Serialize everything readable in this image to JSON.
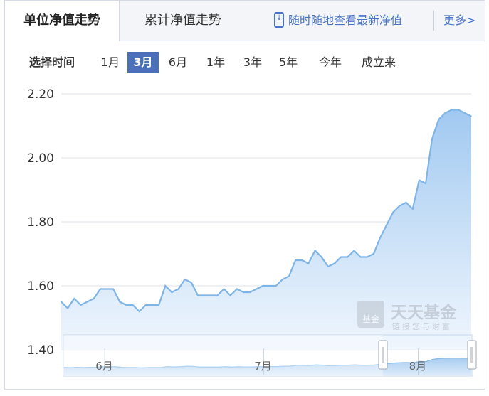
{
  "tabs": {
    "unit_nav": "单位净值走势",
    "accumulated_nav": "累计净值走势"
  },
  "mobile_link": "随时随地查看最新净值",
  "more_link": "更多>",
  "range": {
    "label": "选择时间",
    "options": [
      "1月",
      "3月",
      "6月",
      "1年",
      "3年",
      "5年",
      "今年",
      "成立来"
    ],
    "selected": "3月"
  },
  "watermark": {
    "logo_text": "基金",
    "brand": "天天基金",
    "slogan": "链接您与财富"
  },
  "colors": {
    "line": "#7eb4e6",
    "fill_top": "#9cc6f0",
    "fill_bottom": "#eaf3fc",
    "grid": "#dde1ea",
    "accent": "#4a70b8"
  },
  "chart_data": {
    "type": "area",
    "ylim": [
      1.4,
      2.2
    ],
    "yticks": [
      "1.40",
      "1.60",
      "1.80",
      "2.00",
      "2.20"
    ],
    "x": [
      0,
      1,
      2,
      3,
      4,
      5,
      6,
      7,
      8,
      9,
      10,
      11,
      12,
      13,
      14,
      15,
      16,
      17,
      18,
      19,
      20,
      21,
      22,
      23,
      24,
      25,
      26,
      27,
      28,
      29,
      30,
      31,
      32,
      33,
      34,
      35,
      36,
      37,
      38,
      39,
      40,
      41,
      42,
      43,
      44,
      45,
      46,
      47,
      48,
      49,
      50,
      51,
      52,
      53,
      54,
      55,
      56,
      57,
      58,
      59,
      60,
      61,
      62,
      63
    ],
    "y": [
      1.55,
      1.53,
      1.56,
      1.54,
      1.55,
      1.56,
      1.59,
      1.59,
      1.59,
      1.55,
      1.54,
      1.54,
      1.52,
      1.54,
      1.54,
      1.54,
      1.6,
      1.58,
      1.59,
      1.62,
      1.61,
      1.57,
      1.57,
      1.57,
      1.57,
      1.59,
      1.57,
      1.59,
      1.58,
      1.58,
      1.59,
      1.6,
      1.6,
      1.6,
      1.62,
      1.63,
      1.68,
      1.68,
      1.67,
      1.71,
      1.69,
      1.66,
      1.67,
      1.69,
      1.69,
      1.71,
      1.69,
      1.69,
      1.7,
      1.75,
      1.79,
      1.83,
      1.85,
      1.86,
      1.84,
      1.93,
      1.92,
      2.06,
      2.12,
      2.14,
      2.15,
      2.15,
      2.14,
      2.13
    ],
    "navigator": {
      "month_labels": [
        "6月",
        "7月",
        "8月"
      ],
      "month_x": [
        0.1,
        0.49,
        0.87
      ]
    }
  }
}
